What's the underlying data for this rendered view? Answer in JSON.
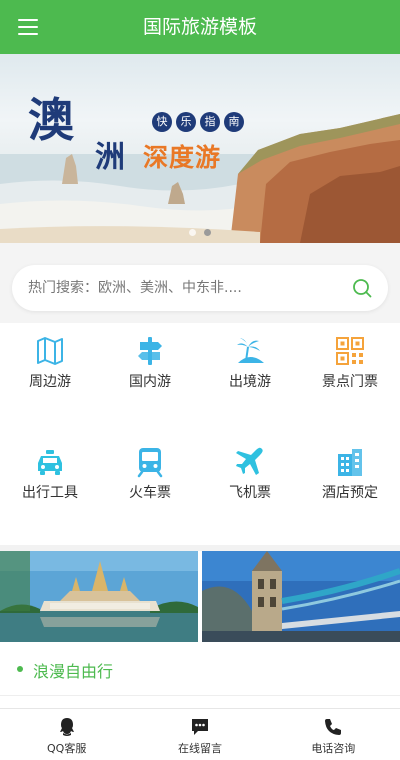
{
  "header": {
    "title": "国际旅游模板"
  },
  "banner": {
    "title_big": "澳",
    "title_mid": "洲",
    "title_orange": "深度游",
    "tags": [
      "快",
      "乐",
      "指",
      "南"
    ]
  },
  "search": {
    "placeholder": "热门搜索：欧洲、美洲、中东非...."
  },
  "categories": [
    {
      "label": "周边游",
      "icon": "map-icon"
    },
    {
      "label": "国内游",
      "icon": "signpost-icon"
    },
    {
      "label": "出境游",
      "icon": "beach-icon"
    },
    {
      "label": "景点门票",
      "icon": "qr-code-icon"
    },
    {
      "label": "出行工具",
      "icon": "taxi-icon"
    },
    {
      "label": "火车票",
      "icon": "train-icon"
    },
    {
      "label": "飞机票",
      "icon": "airplane-icon"
    },
    {
      "label": "酒店预定",
      "icon": "hotel-icon"
    }
  ],
  "section": {
    "title": "浪漫自由行"
  },
  "bottom_nav": [
    {
      "label": "QQ客服",
      "icon": "qq-icon"
    },
    {
      "label": "在线留言",
      "icon": "message-icon"
    },
    {
      "label": "电话咨询",
      "icon": "phone-icon"
    }
  ],
  "colors": {
    "brand": "#4dba4f",
    "icon_blue": "#3cb4e6",
    "icon_orange": "#f5a33b"
  }
}
